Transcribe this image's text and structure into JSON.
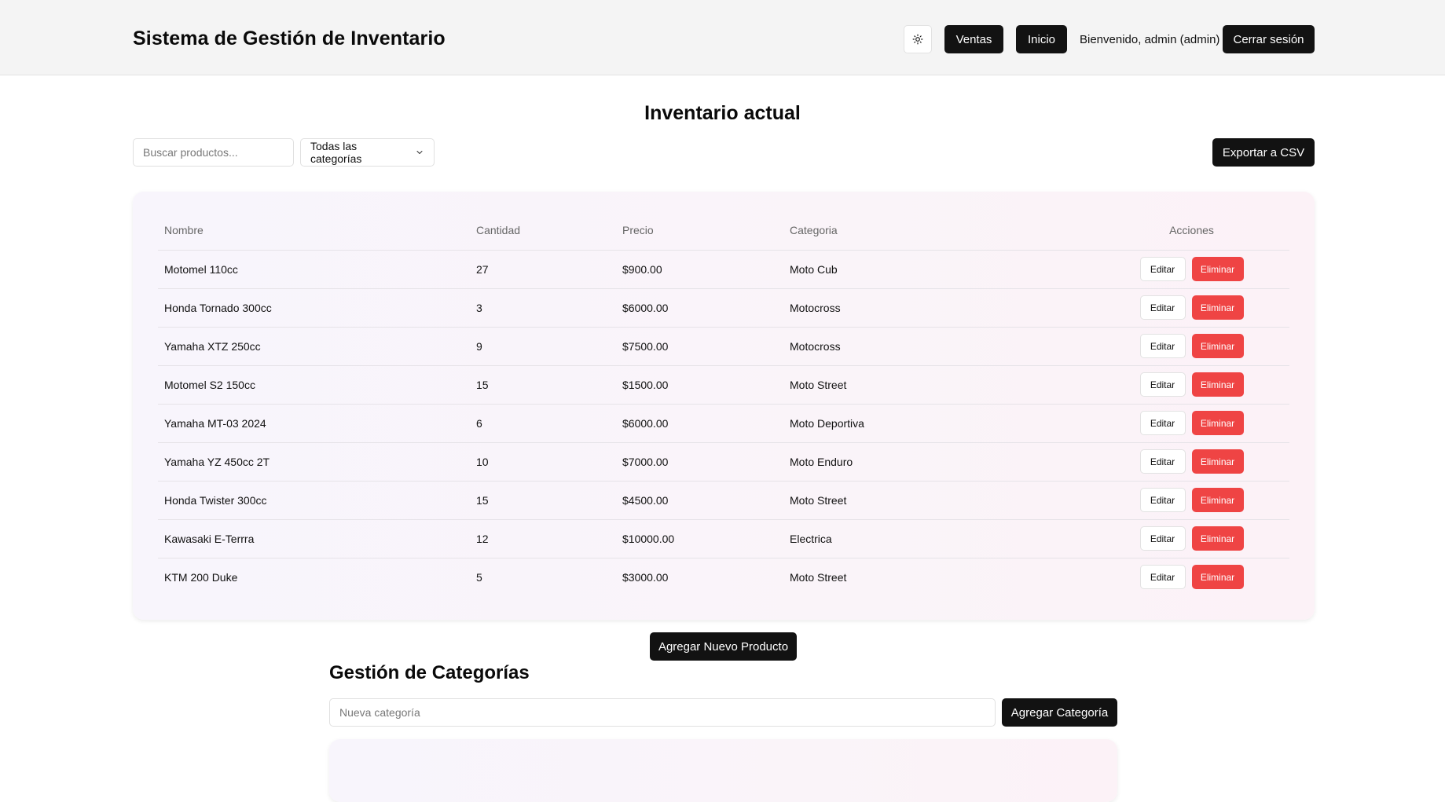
{
  "header": {
    "title": "Sistema de Gestión de Inventario",
    "theme_icon": "sun-icon",
    "nav_ventas": "Ventas",
    "nav_inicio": "Inicio",
    "welcome": "Bienvenido, admin (admin)",
    "logout": "Cerrar sesión"
  },
  "main": {
    "title": "Inventario actual",
    "search_placeholder": "Buscar productos...",
    "category_filter": "Todas las categorías",
    "export_label": "Exportar a CSV",
    "add_product_label": "Agregar Nuevo Producto"
  },
  "table": {
    "columns": [
      "Nombre",
      "Cantidad",
      "Precio",
      "Categoria",
      "Acciones"
    ],
    "edit_label": "Editar",
    "delete_label": "Eliminar",
    "rows": [
      {
        "nombre": "Motomel 110cc",
        "cantidad": "27",
        "precio": "$900.00",
        "categoria": "Moto Cub"
      },
      {
        "nombre": "Honda Tornado 300cc",
        "cantidad": "3",
        "precio": "$6000.00",
        "categoria": "Motocross"
      },
      {
        "nombre": "Yamaha XTZ 250cc",
        "cantidad": "9",
        "precio": "$7500.00",
        "categoria": "Motocross"
      },
      {
        "nombre": "Motomel S2 150cc",
        "cantidad": "15",
        "precio": "$1500.00",
        "categoria": "Moto Street"
      },
      {
        "nombre": "Yamaha MT-03 2024",
        "cantidad": "6",
        "precio": "$6000.00",
        "categoria": "Moto Deportiva"
      },
      {
        "nombre": "Yamaha YZ 450cc 2T",
        "cantidad": "10",
        "precio": "$7000.00",
        "categoria": "Moto Enduro"
      },
      {
        "nombre": "Honda Twister 300cc",
        "cantidad": "15",
        "precio": "$4500.00",
        "categoria": "Moto Street"
      },
      {
        "nombre": "Kawasaki E-Terrra",
        "cantidad": "12",
        "precio": "$10000.00",
        "categoria": "Electrica"
      },
      {
        "nombre": "KTM 200 Duke",
        "cantidad": "5",
        "precio": "$3000.00",
        "categoria": "Moto Street"
      }
    ]
  },
  "categories": {
    "title": "Gestión de Categorías",
    "new_placeholder": "Nueva categoría",
    "add_label": "Agregar Categoría"
  },
  "colors": {
    "dark_button": "#121212",
    "delete_red": "#ef4444",
    "header_bg": "#f4f4f4"
  }
}
